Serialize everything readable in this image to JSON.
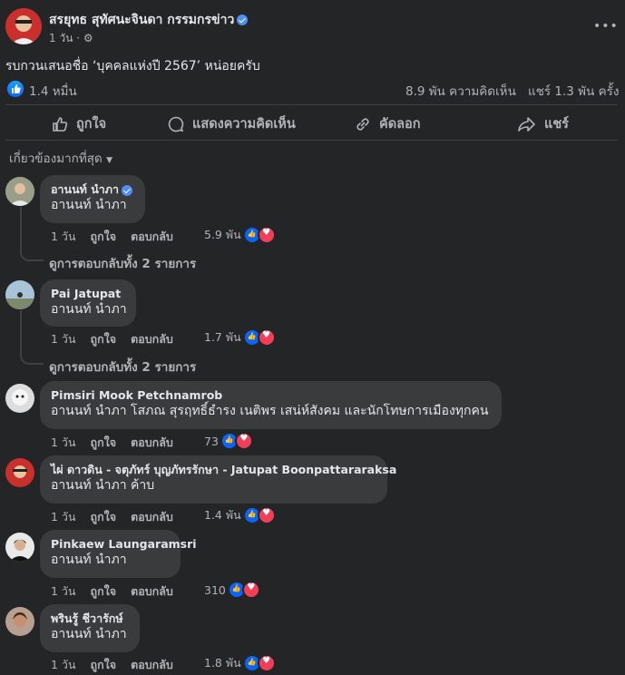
{
  "post": {
    "author": "สรยุทธ สุทัศนะจินดา กรรมกรข่าว",
    "time": "1 วัน",
    "text": "รบกวนเสนอชื่อ ‘บุคคลแห่งปี 2567’ หน่อยครับ",
    "reactions": "1.4 หมื่น",
    "comments_count": "8.9 พัน ความคิดเห็น",
    "shares_count": "แชร์ 1.3 พัน ครั้ง"
  },
  "actions": {
    "like": "ถูกใจ",
    "comment": "แสดงความคิดเห็น",
    "copy": "คัดลอก",
    "share": "แชร์"
  },
  "sort_label": "เกี่ยวข้องมากที่สุด",
  "comment_actions": {
    "like": "ถูกใจ",
    "reply": "ตอบกลับ"
  },
  "comments": [
    {
      "name": "อานนท์ นำภา",
      "text": "อานนท์ นำภา",
      "time": "1 วัน",
      "reactions": "5.9 พัน",
      "replies": "ดูการตอบกลับทั้ง 2 รายการ"
    },
    {
      "name": "Pai Jatupat",
      "text": "อานนท์ นำภา",
      "time": "1 วัน",
      "reactions": "1.7 พัน",
      "replies": "ดูการตอบกลับทั้ง 2 รายการ"
    },
    {
      "name": "Pimsiri Mook Petchnamrob",
      "text": "อานนท์ นำภา โสภณ สุรฤทธิ์ธำรง เนติพร เสน่ห์สังคม และนักโทษการเมืองทุกคน",
      "time": "1 วัน",
      "reactions": "73"
    },
    {
      "name": "ไผ่ ดาวดิน - จตุภัทร์ บุญภัทรรักษา - Jatupat Boonpattararaksa",
      "text": "อานนท์ นำภา ค้าบ",
      "time": "1 วัน",
      "reactions": "1.4 พัน"
    },
    {
      "name": "Pinkaew Laungaramsri",
      "text": "อานนท์ นำภา",
      "time": "1 วัน",
      "reactions": "310"
    },
    {
      "name": "พรินรู้ ชีวารักษ์",
      "text": "อานนท์ นำภา",
      "time": "1 วัน",
      "reactions": "1.8 พัน"
    }
  ],
  "colors": {
    "bg": "#242526",
    "bubble": "#3a3b3c",
    "text": "#e4e6eb",
    "muted": "#b0b3b8",
    "like": "#0866ff",
    "love": "#f33e58",
    "verified": "#4e8ef7"
  }
}
